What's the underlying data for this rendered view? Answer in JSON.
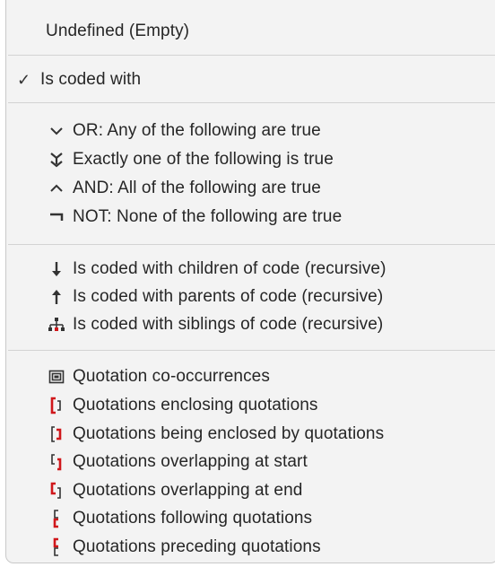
{
  "menu": {
    "undefined_item": "Undefined (Empty)",
    "coded_with": {
      "label": "Is coded with",
      "checkmark": "✓",
      "checked": true
    },
    "operators": [
      {
        "label": "OR: Any of the following are true",
        "icon": "chevron-down-icon"
      },
      {
        "label": "Exactly one of the following is true",
        "icon": "exactly-one-icon"
      },
      {
        "label": "AND: All of the following are true",
        "icon": "chevron-up-icon"
      },
      {
        "label": "NOT: None of the following are true",
        "icon": "not-sign-icon"
      }
    ],
    "hierarchy": [
      {
        "label": "Is coded with children of code (recursive)",
        "icon": "arrow-down-icon"
      },
      {
        "label": "Is coded with parents of code (recursive)",
        "icon": "arrow-up-icon"
      },
      {
        "label": "Is coded with siblings of code (recursive)",
        "icon": "siblings-tree-icon"
      }
    ],
    "quotations": [
      {
        "label": "Quotation co-occurrences",
        "icon": "co-occurrence-icon"
      },
      {
        "label": "Quotations enclosing quotations",
        "icon": "enclosing-bracket-icon"
      },
      {
        "label": "Quotations being enclosed by quotations",
        "icon": "enclosed-bracket-icon"
      },
      {
        "label": "Quotations overlapping at start",
        "icon": "overlap-start-icon"
      },
      {
        "label": "Quotations overlapping at end",
        "icon": "overlap-end-icon"
      },
      {
        "label": "Quotations following quotations",
        "icon": "following-icon"
      },
      {
        "label": "Quotations preceding quotations",
        "icon": "preceding-icon"
      }
    ]
  },
  "colors": {
    "accent_red": "#d0171b",
    "text": "#262626",
    "background": "#f3f3f3"
  }
}
